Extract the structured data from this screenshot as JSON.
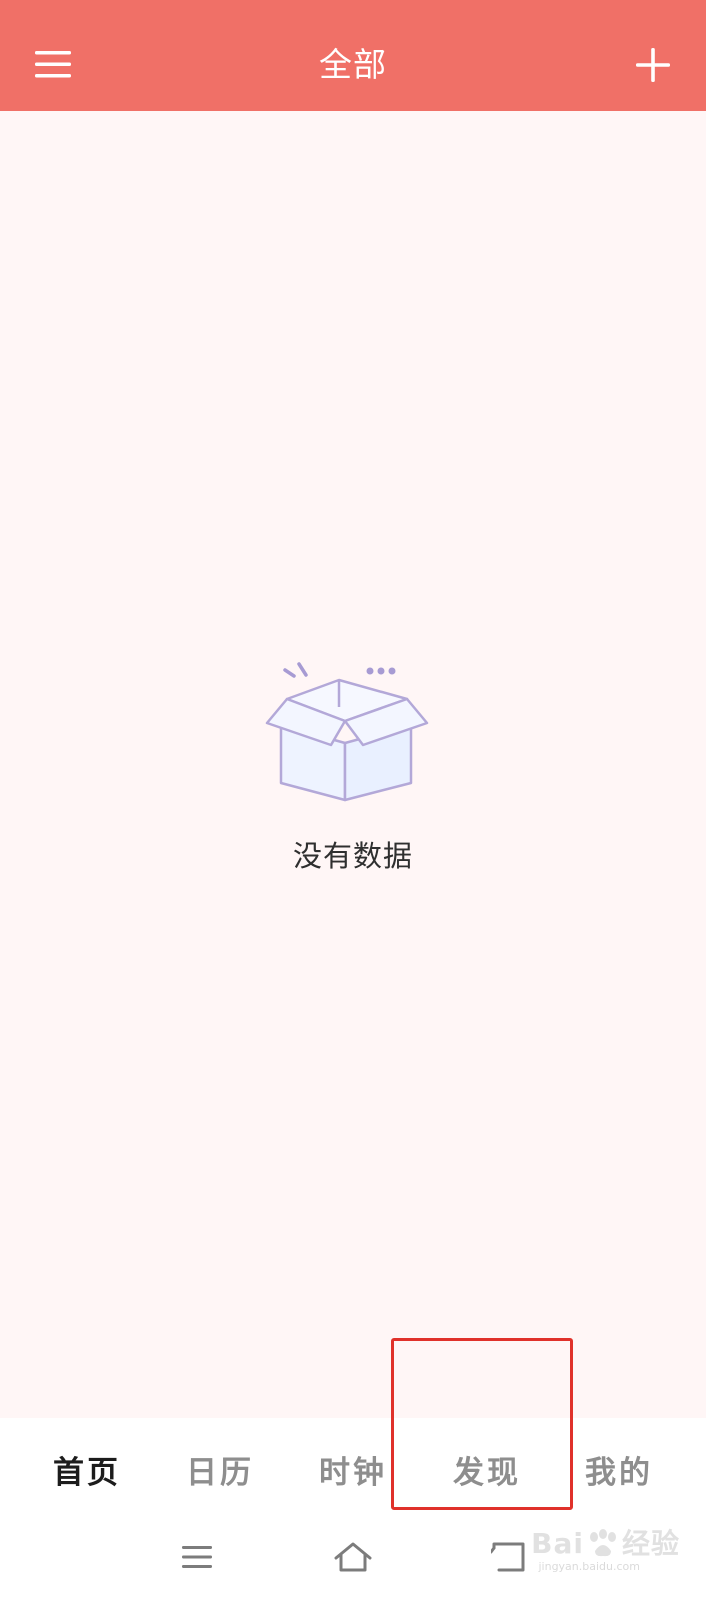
{
  "colors": {
    "app_bar": "#f07067",
    "background": "#fff6f6",
    "nav_active": "#1c1c1c",
    "nav_inactive": "#8e8e8e",
    "highlight_border": "#e0312a",
    "illustration_stroke": "#b3a8d8",
    "illustration_fill": "#eef3ff"
  },
  "app_bar": {
    "title": "全部",
    "menu_icon": "hamburger-menu-icon",
    "add_icon": "plus-icon"
  },
  "empty_state": {
    "icon": "open-box-icon",
    "message": "没有数据"
  },
  "bottom_nav": {
    "items": [
      {
        "label": "首页",
        "active": true
      },
      {
        "label": "日历",
        "active": false
      },
      {
        "label": "时钟",
        "active": false
      },
      {
        "label": "发现",
        "active": false,
        "highlighted": true
      },
      {
        "label": "我的",
        "active": false
      }
    ]
  },
  "system_nav": {
    "menu_icon": "recent-apps-icon",
    "home_icon": "home-icon",
    "back_icon": "back-icon"
  },
  "watermark": {
    "brand": "Bai du 经验",
    "brand_left": "Bai",
    "brand_right": "经验",
    "url": "jingyan.baidu.com"
  }
}
